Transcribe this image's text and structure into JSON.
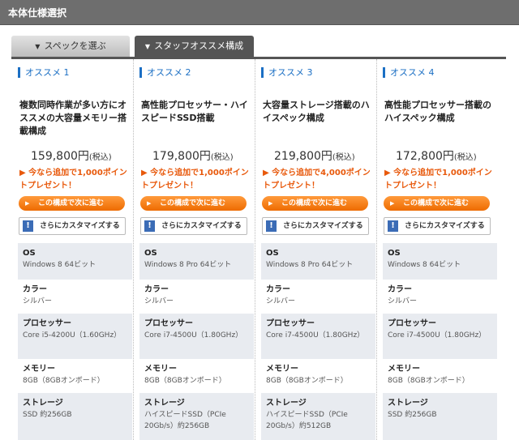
{
  "header": {
    "title": "本体仕様選択"
  },
  "tabs": [
    {
      "label": "スペックを選ぶ"
    },
    {
      "label": "スタッフオススメ構成"
    }
  ],
  "columns": [
    {
      "badge": "オススメ 1",
      "title": "複数同時作業が多い方にオススメの大容量メモリー搭載構成",
      "price": "159,800円",
      "tax": "(税込)",
      "promo": "今なら追加で1,000ポイントプレゼント！",
      "next_label": "この構成で次に進む",
      "customize_label": "さらにカスタマイズする",
      "specs": [
        {
          "label": "OS",
          "value": "Windows 8 64ビット"
        },
        {
          "label": "カラー",
          "value": "シルバー"
        },
        {
          "label": "プロセッサー",
          "value": "Core i5-4200U（1.60GHz）"
        },
        {
          "label": "メモリー",
          "value": "8GB（8GBオンボード）"
        },
        {
          "label": "ストレージ",
          "value": "SSD 約256GB"
        }
      ]
    },
    {
      "badge": "オススメ 2",
      "title": "高性能プロセッサー・ハイスピードSSD搭載",
      "price": "179,800円",
      "tax": "(税込)",
      "promo": "今なら追加で1,000ポイントプレゼント！",
      "next_label": "この構成で次に進む",
      "customize_label": "さらにカスタマイズする",
      "specs": [
        {
          "label": "OS",
          "value": "Windows 8 Pro 64ビット"
        },
        {
          "label": "カラー",
          "value": "シルバー"
        },
        {
          "label": "プロセッサー",
          "value": "Core i7-4500U（1.80GHz）"
        },
        {
          "label": "メモリー",
          "value": "8GB（8GBオンボード）"
        },
        {
          "label": "ストレージ",
          "value": "ハイスピードSSD（PCIe 20Gb/s）約256GB"
        }
      ]
    },
    {
      "badge": "オススメ 3",
      "title": "大容量ストレージ搭載のハイスペック構成",
      "price": "219,800円",
      "tax": "(税込)",
      "promo": "今なら追加で4,000ポイントプレゼント！",
      "next_label": "この構成で次に進む",
      "customize_label": "さらにカスタマイズする",
      "specs": [
        {
          "label": "OS",
          "value": "Windows 8 Pro 64ビット"
        },
        {
          "label": "カラー",
          "value": "シルバー"
        },
        {
          "label": "プロセッサー",
          "value": "Core i7-4500U（1.80GHz）"
        },
        {
          "label": "メモリー",
          "value": "8GB（8GBオンボード）"
        },
        {
          "label": "ストレージ",
          "value": "ハイスピードSSD（PCIe 20Gb/s）約512GB"
        }
      ]
    },
    {
      "badge": "オススメ 4",
      "title": "高性能プロセッサー搭載のハイスペック構成",
      "price": "172,800円",
      "tax": "(税込)",
      "promo": "今なら追加で1,000ポイントプレゼント！",
      "next_label": "この構成で次に進む",
      "customize_label": "さらにカスタマイズする",
      "specs": [
        {
          "label": "OS",
          "value": "Windows 8 64ビット"
        },
        {
          "label": "カラー",
          "value": "シルバー"
        },
        {
          "label": "プロセッサー",
          "value": "Core i7-4500U（1.80GHz）"
        },
        {
          "label": "メモリー",
          "value": "8GB（8GBオンボード）"
        },
        {
          "label": "ストレージ",
          "value": "SSD 約256GB"
        }
      ]
    }
  ]
}
